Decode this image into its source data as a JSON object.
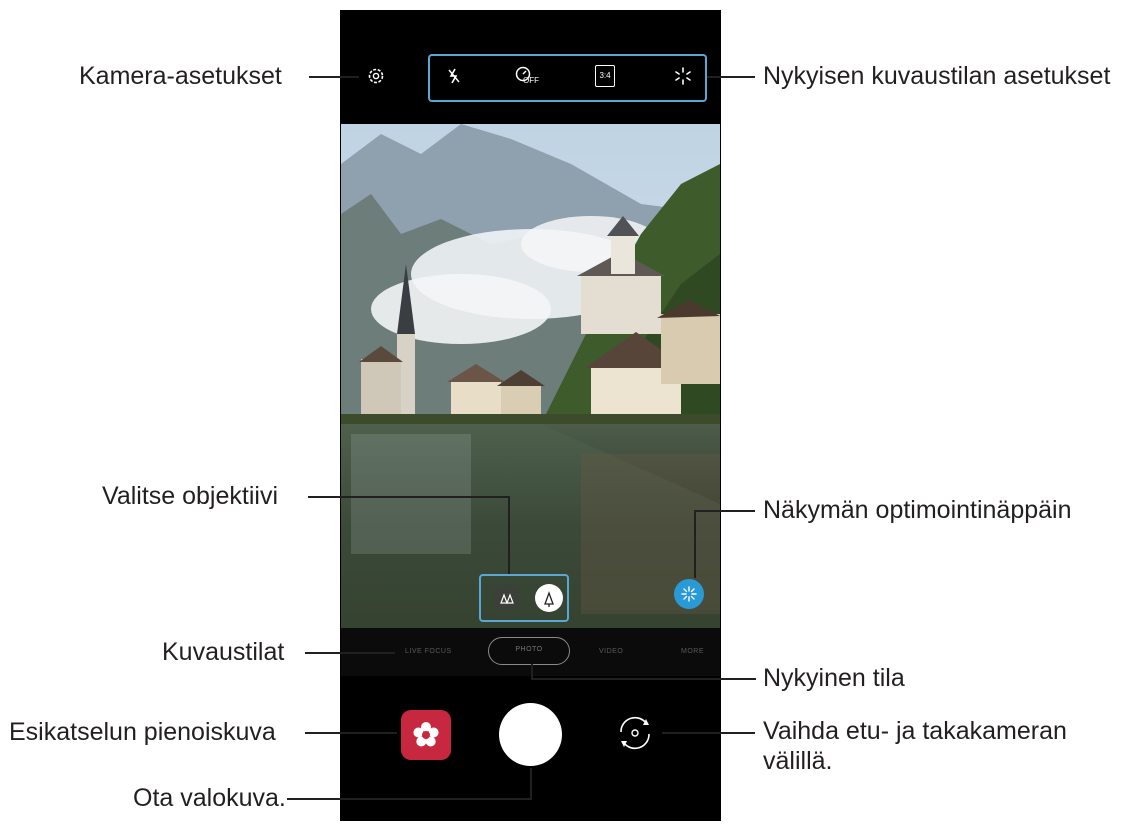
{
  "callouts": {
    "camera_settings": "Kamera-asetukset",
    "current_mode_settings": "Nykyisen kuvaustilan asetukset",
    "select_lens": "Valitse objektiivi",
    "scene_optimizer": "Näkymän optimointinäppäin",
    "shooting_modes": "Kuvaustilat",
    "current_mode": "Nykyinen tila",
    "preview_thumbnail": "Esikatselun pienoiskuva",
    "switch_camera": "Vaihda etu- ja takakameran välillä.",
    "take_photo": "Ota valokuva."
  },
  "modes": {
    "left": "LIVE FOCUS",
    "current": "PHOTO",
    "right1": "VIDEO",
    "right2": "MORE"
  },
  "toolbar": {
    "aspect_ratio": "3:4",
    "timer_state": "OFF"
  },
  "colors": {
    "callout_box": "#5aa7d6",
    "gallery_thumbnail": "#c8283f",
    "scene_optimizer": "#2a9ad6"
  }
}
